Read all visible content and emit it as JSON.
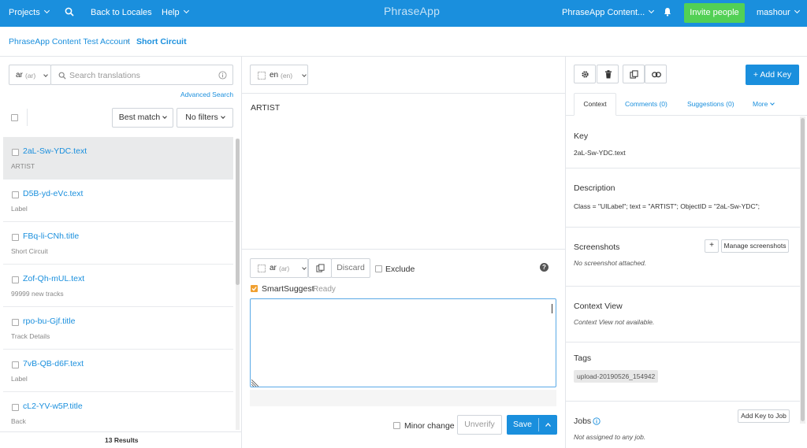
{
  "topbar": {
    "projects": "Projects",
    "back_to_locales": "Back to Locales",
    "help": "Help",
    "logo": "PhraseApp",
    "account": "PhraseApp Content...",
    "invite": "Invite people",
    "user": "mashour"
  },
  "breadcrumb": {
    "account": "PhraseApp Content Test Account",
    "project": "Short Circuit"
  },
  "left": {
    "locale": "ar",
    "locale_code": "(ar)",
    "search_placeholder": "Search translations",
    "advanced_search": "Advanced Search",
    "sort": "Best match",
    "filter": "No filters",
    "keys": [
      {
        "name": "2aL-Sw-YDC.text",
        "desc": "ARTIST"
      },
      {
        "name": "D5B-yd-eVc.text",
        "desc": "Label"
      },
      {
        "name": "FBq-li-CNh.title",
        "desc": "Short Circuit"
      },
      {
        "name": "Zof-Qh-mUL.text",
        "desc": "99999 new tracks"
      },
      {
        "name": "rpo-bu-Gjf.title",
        "desc": "Track Details"
      },
      {
        "name": "7vB-QB-d6F.text",
        "desc": "Label"
      },
      {
        "name": "cL2-YV-w5P.title",
        "desc": "Back"
      }
    ],
    "results": "13 Results"
  },
  "middle": {
    "source_locale": "en",
    "source_locale_code": "(en)",
    "source_text": "ARTIST",
    "target_locale": "ar",
    "target_locale_code": "(ar)",
    "discard": "Discard",
    "exclude": "Exclude",
    "help": "?",
    "smartsuggest": "SmartSuggest",
    "smartsuggest_status": "Ready",
    "translation_value": "",
    "minor_change": "Minor change",
    "unverify": "Unverify",
    "save": "Save"
  },
  "right": {
    "add_key": "+ Add Key",
    "tabs": [
      "Context",
      "Comments (0)",
      "Suggestions (0)",
      "More"
    ],
    "key_title": "Key",
    "key_value": "2aL-Sw-YDC.text",
    "desc_title": "Description",
    "desc_value": "Class = \"UILabel\"; text = \"ARTIST\"; ObjectID = \"2aL-Sw-YDC\";",
    "screenshots_title": "Screenshots",
    "screenshots_plus": "+",
    "manage_screenshots": "Manage screenshots",
    "screenshots_value": "No screenshot attached.",
    "context_view_title": "Context View",
    "context_view_value": "Context View not available.",
    "tags_title": "Tags",
    "tag": "upload-20190526_154942",
    "jobs_title": "Jobs",
    "add_key_to_job": "Add Key to Job",
    "jobs_value": "Not assigned to any job."
  },
  "colors": {
    "topbar": "#1a8fdd",
    "invite": "#52d055",
    "link": "#1a8fdd",
    "save": "#1a8fdd",
    "smartsuggest_check": "#f0a030"
  },
  "icons": [
    "search-icon",
    "bell-icon",
    "info-icon",
    "gear-icon",
    "trash-icon",
    "copy-icon",
    "link-icon",
    "question-icon"
  ]
}
